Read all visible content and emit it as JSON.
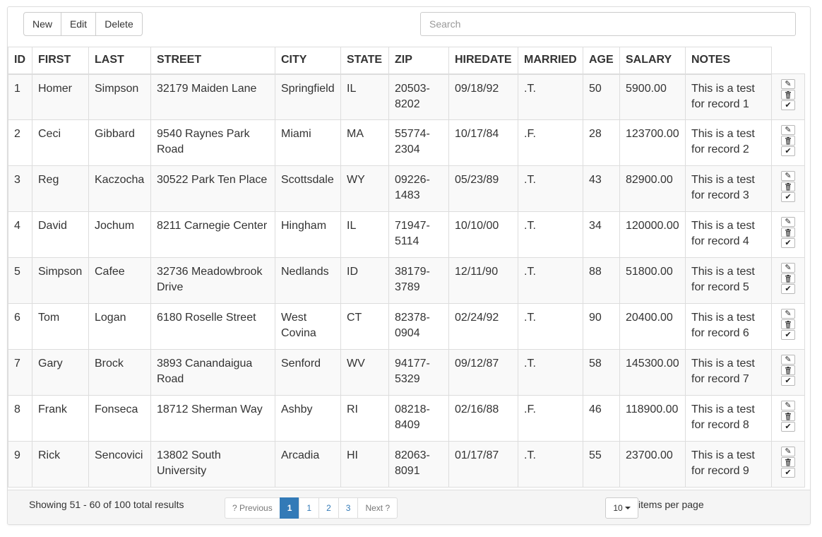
{
  "toolbar": {
    "new_label": "New",
    "edit_label": "Edit",
    "delete_label": "Delete"
  },
  "search": {
    "placeholder": "Search",
    "value": ""
  },
  "table": {
    "columns": [
      "ID",
      "FIRST",
      "LAST",
      "STREET",
      "CITY",
      "STATE",
      "ZIP",
      "HIREDATE",
      "MARRIED",
      "AGE",
      "SALARY",
      "NOTES"
    ],
    "rows": [
      [
        "1",
        "Homer",
        "Simpson",
        "32179 Maiden Lane",
        "Springfield",
        "IL",
        "20503-8202",
        "09/18/92",
        ".T.",
        "50",
        "5900.00",
        "This is a test for record 1"
      ],
      [
        "2",
        "Ceci",
        "Gibbard",
        "9540 Raynes Park Road",
        "Miami",
        "MA",
        "55774-2304",
        "10/17/84",
        ".F.",
        "28",
        "123700.00",
        "This is a test for record 2"
      ],
      [
        "3",
        "Reg",
        "Kaczocha",
        "30522 Park Ten Place",
        "Scottsdale",
        "WY",
        "09226-1483",
        "05/23/89",
        ".T.",
        "43",
        "82900.00",
        "This is a test for record 3"
      ],
      [
        "4",
        "David",
        "Jochum",
        "8211 Carnegie Center",
        "Hingham",
        "IL",
        "71947-5114",
        "10/10/00",
        ".T.",
        "34",
        "120000.00",
        "This is a test for record 4"
      ],
      [
        "5",
        "Simpson",
        "Cafee",
        "32736 Meadowbrook Drive",
        "Nedlands",
        "ID",
        "38179-3789",
        "12/11/90",
        ".T.",
        "88",
        "51800.00",
        "This is a test for record 5"
      ],
      [
        "6",
        "Tom",
        "Logan",
        "6180 Roselle Street",
        "West Covina",
        "CT",
        "82378-0904",
        "02/24/92",
        ".T.",
        "90",
        "20400.00",
        "This is a test for record 6"
      ],
      [
        "7",
        "Gary",
        "Brock",
        "3893 Canandaigua Road",
        "Senford",
        "WV",
        "94177-5329",
        "09/12/87",
        ".T.",
        "58",
        "145300.00",
        "This is a test for record 7"
      ],
      [
        "8",
        "Frank",
        "Fonseca",
        "18712 Sherman Way",
        "Ashby",
        "RI",
        "08218-8409",
        "02/16/88",
        ".F.",
        "46",
        "118900.00",
        "This is a test for record 8"
      ],
      [
        "9",
        "Rick",
        "Sencovici",
        "13802 South University",
        "Arcadia",
        "HI",
        "82063-8091",
        "01/17/87",
        ".T.",
        "55",
        "23700.00",
        "This is a test for record 9"
      ]
    ],
    "row_actions": [
      "pencil-icon",
      "trash-icon",
      "check-icon"
    ]
  },
  "footer": {
    "showing": "Showing 51 - 60 of 100 total results",
    "pagination": {
      "previous": "? Previous",
      "pages": [
        "1",
        "1",
        "2",
        "3"
      ],
      "active_index": 0,
      "next": "Next ?"
    },
    "per_page_value": "10",
    "per_page_label": "items per page"
  },
  "colors": {
    "accent": "#337ab7",
    "border": "#dddddd",
    "stripe": "#f9f9f9",
    "footer_bg": "#f5f5f5"
  }
}
